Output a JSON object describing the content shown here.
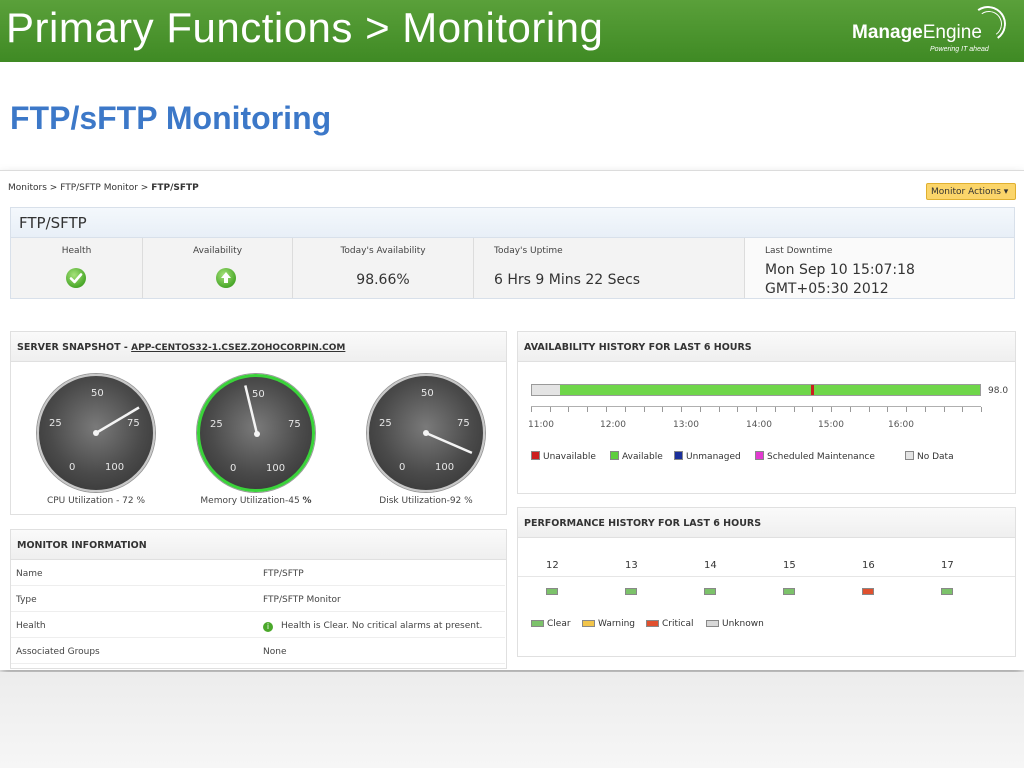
{
  "slide": {
    "title": "Primary Functions > Monitoring",
    "subtitle": "FTP/sFTP Monitoring",
    "logo": {
      "name_bold": "Manage",
      "name_light": "Engine",
      "tagline": "Powering IT ahead"
    }
  },
  "breadcrumb": {
    "part1": "Monitors",
    "sep1": ">",
    "part2": "FTP/SFTP Monitor",
    "sep2": ">",
    "current": "FTP/SFTP"
  },
  "actions": {
    "monitor_actions": "Monitor Actions ▾"
  },
  "summary": {
    "title": "FTP/SFTP",
    "health_label": "Health",
    "availability_label": "Availability",
    "todays_availability_label": "Today's Availability",
    "todays_availability_value": "98.66%",
    "todays_uptime_label": "Today's Uptime",
    "todays_uptime_value": "6 Hrs 9 Mins 22 Secs",
    "last_downtime_label": "Last Downtime",
    "last_downtime_line1": "Mon Sep 10 15:07:18",
    "last_downtime_line2": "GMT+05:30 2012"
  },
  "snapshot": {
    "title_prefix": "SERVER SNAPSHOT - ",
    "host": "APP-CENTOS32-1.CSEZ.ZOHOCORPIN.COM",
    "gauges": [
      {
        "caption_text": "CPU Utilization - 72 %",
        "value": 72
      },
      {
        "caption_text": "Memory Utilization-45 ",
        "caption_bold": "%",
        "value": 45
      },
      {
        "caption_text": "Disk Utilization-92 %",
        "value": 92
      }
    ],
    "gauge_ticks": {
      "zero": "0",
      "quarter": "25",
      "half": "50",
      "three_quarter": "75",
      "full": "100"
    }
  },
  "monitor_info": {
    "title": "MONITOR INFORMATION",
    "rows": [
      {
        "label": "Name",
        "value": "FTP/SFTP"
      },
      {
        "label": "Type",
        "value": "FTP/SFTP Monitor"
      },
      {
        "label": "Health",
        "value": "Health is Clear. No critical alarms at present."
      },
      {
        "label": "Associated Groups",
        "value": "None"
      }
    ]
  },
  "availability_history": {
    "title": "AVAILABILITY HISTORY FOR LAST 6 HOURS",
    "value_label": "98.0",
    "segments": [
      {
        "state": "No Data",
        "fraction": 0.062
      },
      {
        "state": "Available",
        "fraction": 0.56
      },
      {
        "state": "Unavailable",
        "fraction": 0.008
      },
      {
        "state": "Available",
        "fraction": 0.37
      }
    ],
    "times": [
      "11:00",
      "12:00",
      "13:00",
      "14:00",
      "15:00",
      "16:00"
    ],
    "legend": [
      {
        "label": "Unavailable",
        "color": "#cc1f1f"
      },
      {
        "label": "Available",
        "color": "#5fcf3f"
      },
      {
        "label": "Unmanaged",
        "color": "#1b2f9a"
      },
      {
        "label": "Scheduled Maintenance",
        "color": "#e23ad0"
      },
      {
        "label": "No Data",
        "color": "#e4e4e4"
      }
    ]
  },
  "performance_history": {
    "title": "PERFORMANCE HISTORY FOR LAST 6 HOURS",
    "hours": [
      {
        "label": "12",
        "status": "Clear"
      },
      {
        "label": "13",
        "status": "Clear"
      },
      {
        "label": "14",
        "status": "Clear"
      },
      {
        "label": "15",
        "status": "Clear"
      },
      {
        "label": "16",
        "status": "Critical"
      },
      {
        "label": "17",
        "status": "Clear"
      }
    ],
    "legend": [
      {
        "label": "Clear",
        "color": "#7cc26a"
      },
      {
        "label": "Warning",
        "color": "#f2c54a"
      },
      {
        "label": "Critical",
        "color": "#e0502e"
      },
      {
        "label": "Unknown",
        "color": "#d8d8d8"
      }
    ]
  }
}
